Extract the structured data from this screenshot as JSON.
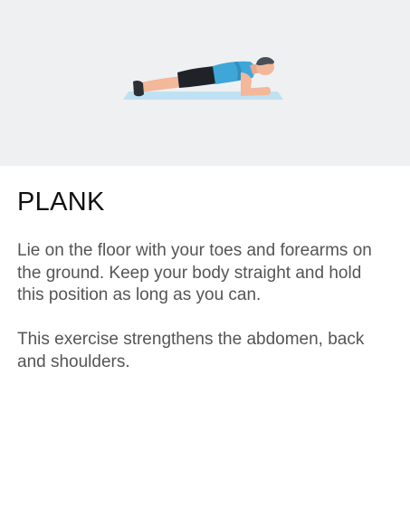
{
  "exercise": {
    "title": "PLANK",
    "description": [
      "Lie on the floor with your toes and forearms on the ground. Keep your body straight and hold this position as long as you can.",
      "This exercise strengthens the abdomen, back and shoulders."
    ],
    "illustration_icon": "person-plank-illustration"
  },
  "colors": {
    "illustration_bg": "#eef0f2",
    "mat": "#bfe2f2",
    "shirt": "#3ea7d8",
    "shorts": "#1f2329",
    "skin": "#f3b79a",
    "title_text": "#111111",
    "body_text": "#555555"
  }
}
